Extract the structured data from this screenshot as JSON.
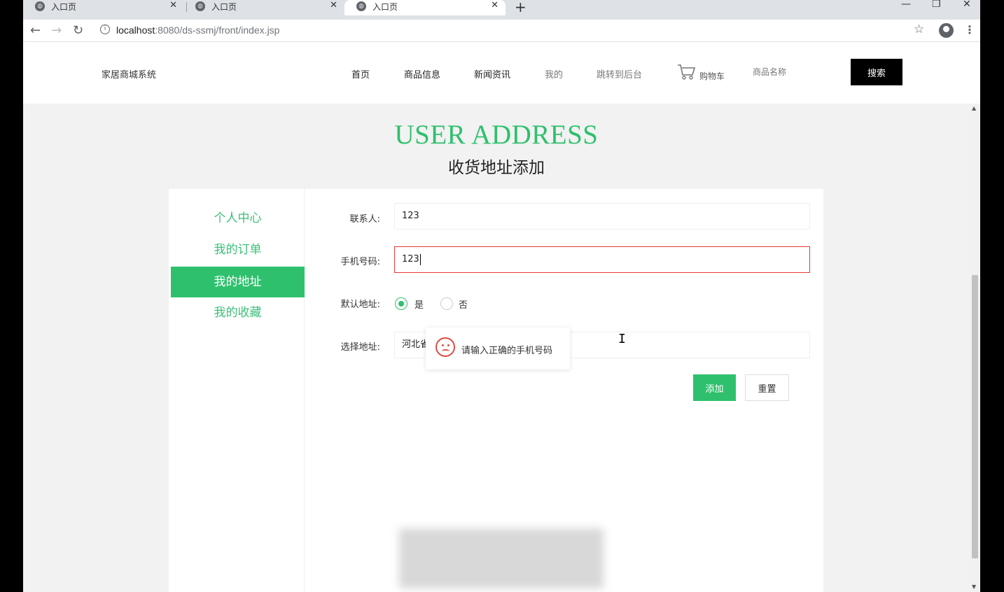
{
  "browser": {
    "tabs": [
      {
        "title": "入口页",
        "close": "✕"
      },
      {
        "title": "入口页",
        "close": "✕"
      },
      {
        "title": "入口页",
        "close": "✕"
      }
    ],
    "new_tab": "+",
    "window_controls": {
      "minimize": "—",
      "restore": "❐",
      "close": "✕"
    },
    "url_host": "localhost",
    "url_port": ":8080",
    "url_path": "/ds-ssmj/front/index.jsp"
  },
  "site": {
    "brand": "家居商城系统",
    "nav": [
      "首页",
      "商品信息",
      "新闻资讯",
      "我的",
      "跳转到后台"
    ],
    "cart_label": "购物车",
    "search_placeholder": "商品名称",
    "search_button": "搜索"
  },
  "page": {
    "title_en": "USER ADDRESS",
    "title_cn": "收货地址添加"
  },
  "sidebar": {
    "items": [
      {
        "label": "个人中心",
        "active": false
      },
      {
        "label": "我的订单",
        "active": false
      },
      {
        "label": "我的地址",
        "active": true
      },
      {
        "label": "我的收藏",
        "active": false
      }
    ]
  },
  "form": {
    "contact_label": "联系人:",
    "contact_value": "123",
    "phone_label": "手机号码:",
    "phone_value": "123",
    "default_label": "默认地址:",
    "default_yes": "是",
    "default_no": "否",
    "default_selected": "是",
    "address_label": "选择地址:",
    "address_value": "河北省",
    "add_button": "添加",
    "reset_button": "重置"
  },
  "tooltip": {
    "message": "请输入正确的手机号码",
    "icon": "sad-face-icon"
  },
  "colors": {
    "accent": "#2fc06e",
    "error": "#e53935"
  }
}
